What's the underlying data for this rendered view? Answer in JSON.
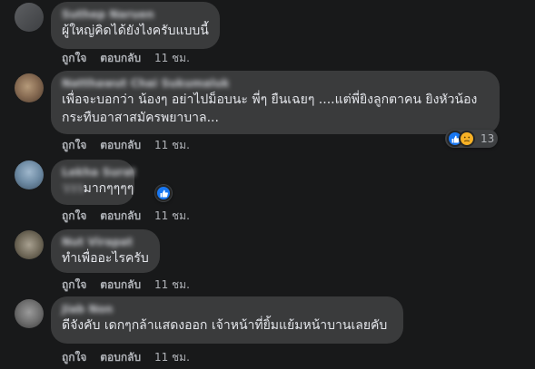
{
  "comments": [
    {
      "author": "Suthep Naruen",
      "text": "ผู้ใหญ่คิดได้ยังไงครับแบบนี้",
      "actions": {
        "like": "ถูกใจ",
        "reply": "ตอบกลับ",
        "time": "11 ชม."
      }
    },
    {
      "author": "Natthawut Chai Sukumaluk",
      "text_line1": "เพื่อจะบอกว่า น้องๆ อย่าไปม็อบนะ พี่ๆ ยืนเฉยๆ ....แต่พี่ยิงลูกตาคน ยิงหัวน้อง",
      "text_line2": "กระทืบอาสาสมัครพยาบาล...",
      "actions": {
        "like": "ถูกใจ",
        "reply": "ตอบกลับ",
        "time": "11 ชม."
      },
      "reactions": {
        "count": "13",
        "icons": [
          "like-icon",
          "sad-icon"
        ]
      }
    },
    {
      "author": "Lekha Surat",
      "text_blur": "ววว",
      "text": "มากๆๆๆๆ",
      "actions": {
        "like": "ถูกใจ",
        "reply": "ตอบกลับ",
        "time": "11 ชม."
      },
      "reactions": {
        "icons": [
          "like-icon"
        ]
      }
    },
    {
      "author": "Nut Virapat",
      "text": "ทำเพื่ออะไรครับ",
      "actions": {
        "like": "ถูกใจ",
        "reply": "ตอบกลับ",
        "time": "11 ชม."
      }
    },
    {
      "author": "Jiab Non",
      "text": "ดีจังคับ เดกๆกล้าแสดงออก เจ้าหน้าที่ยิ้มแย้มหน้าบานเลยคับ",
      "actions": {
        "like": "ถูกใจ",
        "reply": "ตอบกลับ",
        "time": "11 ชม."
      }
    }
  ],
  "colors": {
    "background": "#18191a",
    "bubble": "#3a3b3c",
    "text": "#e4e6eb",
    "secondary_text": "#b0b3b8",
    "like_blue": "#1877f2",
    "sad_yellow": "#f7b125"
  }
}
